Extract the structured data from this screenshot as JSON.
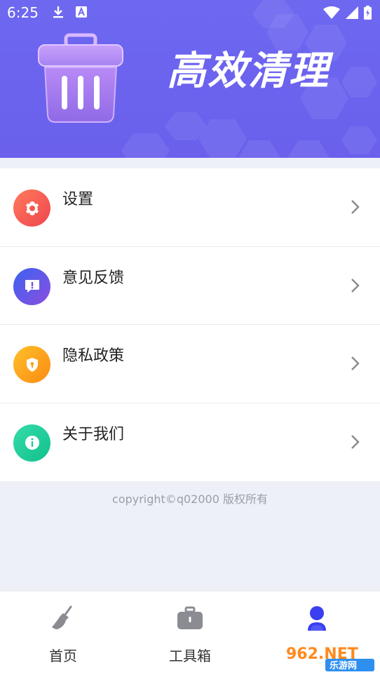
{
  "status_bar": {
    "time": "6:25",
    "icons": [
      "download-icon",
      "a-badge-icon",
      "wifi-icon",
      "signal-icon",
      "battery-icon"
    ]
  },
  "header": {
    "title": "高效清理",
    "icon": "trash-icon",
    "bg_color": "#6b63ee"
  },
  "menu": {
    "items": [
      {
        "label": "设置",
        "icon": "gear-icon",
        "color": "#f45b4e"
      },
      {
        "label": "意见反馈",
        "icon": "feedback-icon",
        "color": "#6b55e8"
      },
      {
        "label": "隐私政策",
        "icon": "shield-icon",
        "color": "#fba21a"
      },
      {
        "label": "关于我们",
        "icon": "info-icon",
        "color": "#1fce9a"
      }
    ]
  },
  "footer": {
    "copyright": "copyright©q02000 版权所有"
  },
  "bottom_nav": {
    "items": [
      {
        "label": "首页",
        "icon": "broom-icon"
      },
      {
        "label": "工具箱",
        "icon": "toolbox-icon"
      },
      {
        "label": "",
        "icon": "user-icon",
        "active": true
      }
    ],
    "active_color": "#3a3ff0"
  },
  "watermark": {
    "text_top": "962.NET",
    "text_bottom": "乐游网"
  }
}
